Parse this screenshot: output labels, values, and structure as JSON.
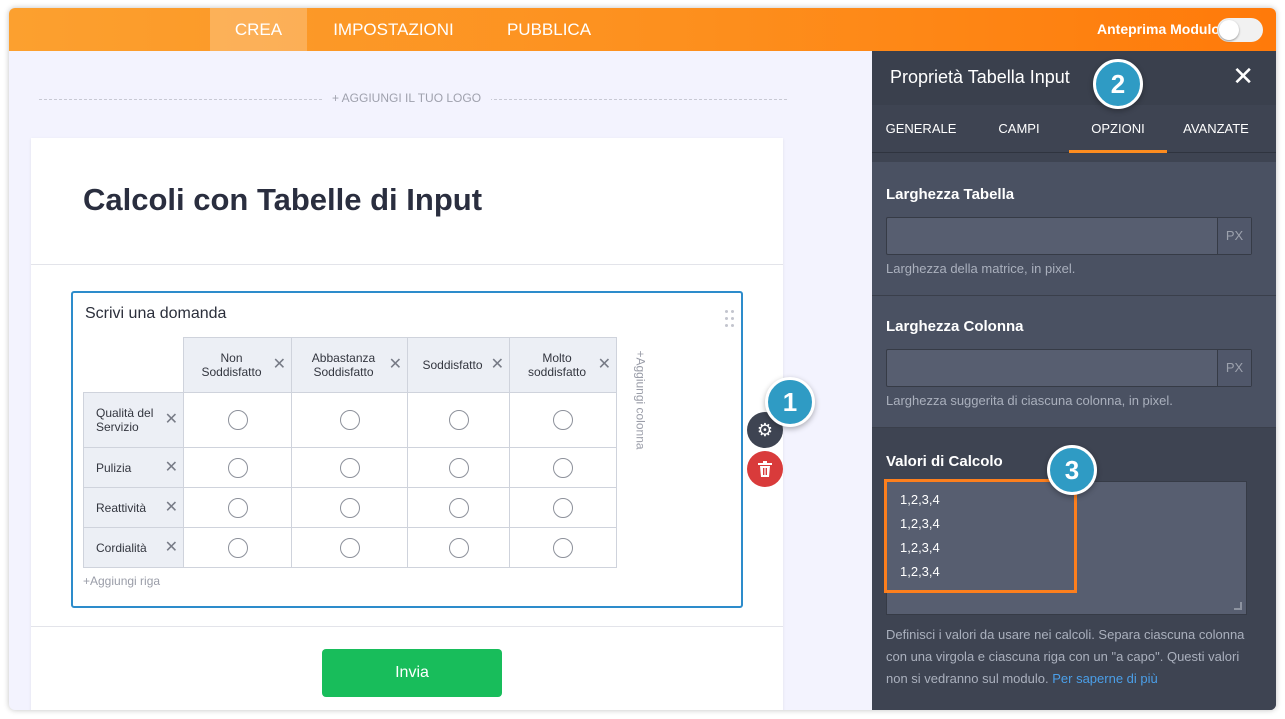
{
  "topbar": {
    "tabs": [
      {
        "label": "CREA"
      },
      {
        "label": "IMPOSTAZIONI"
      },
      {
        "label": "PUBBLICA"
      }
    ],
    "preview_label": "Anteprima Modulo"
  },
  "canvas": {
    "logo_text": "+ AGGIUNGI IL TUO LOGO",
    "form_title": "Calcoli con Tabelle di Input",
    "question": "Scrivi una domanda",
    "columns": [
      "Non Soddisfatto",
      "Abbastanza Soddisfatto",
      "Soddisfatto",
      "Molto soddisfatto"
    ],
    "rows": [
      "Qualità del Servizio",
      "Pulizia",
      "Reattività",
      "Cordialità"
    ],
    "add_column": "+Aggiungi colonna",
    "add_row": "+Aggiungi riga",
    "submit_label": "Invia"
  },
  "panel": {
    "title": "Proprietà Tabella Input",
    "tabs": [
      {
        "label": "GENERALE"
      },
      {
        "label": "CAMPI"
      },
      {
        "label": "OPZIONI"
      },
      {
        "label": "AVANZATE"
      }
    ],
    "table_width": {
      "label": "Larghezza Tabella",
      "value": "",
      "unit": "PX",
      "hint": "Larghezza della matrice, in pixel."
    },
    "column_width": {
      "label": "Larghezza Colonna",
      "value": "",
      "unit": "PX",
      "hint": "Larghezza suggerita di ciascuna colonna, in pixel."
    },
    "calc_values": {
      "label": "Valori di Calcolo",
      "lines": [
        "1,2,3,4",
        "1,2,3,4",
        "1,2,3,4",
        "1,2,3,4"
      ],
      "hint": "Definisci i valori da usare nei calcoli. Separa ciascuna colonna con una virgola e ciascuna riga con un \"a capo\". Questi valori non si vedranno sul modulo.",
      "more_link": "Per saperne di più"
    }
  },
  "callouts": [
    "1",
    "2",
    "3"
  ],
  "colors": {
    "accent": "#fd8c1f",
    "callout": "#2f9bc4",
    "submit": "#18bd5b",
    "panel": "#3e4452"
  }
}
